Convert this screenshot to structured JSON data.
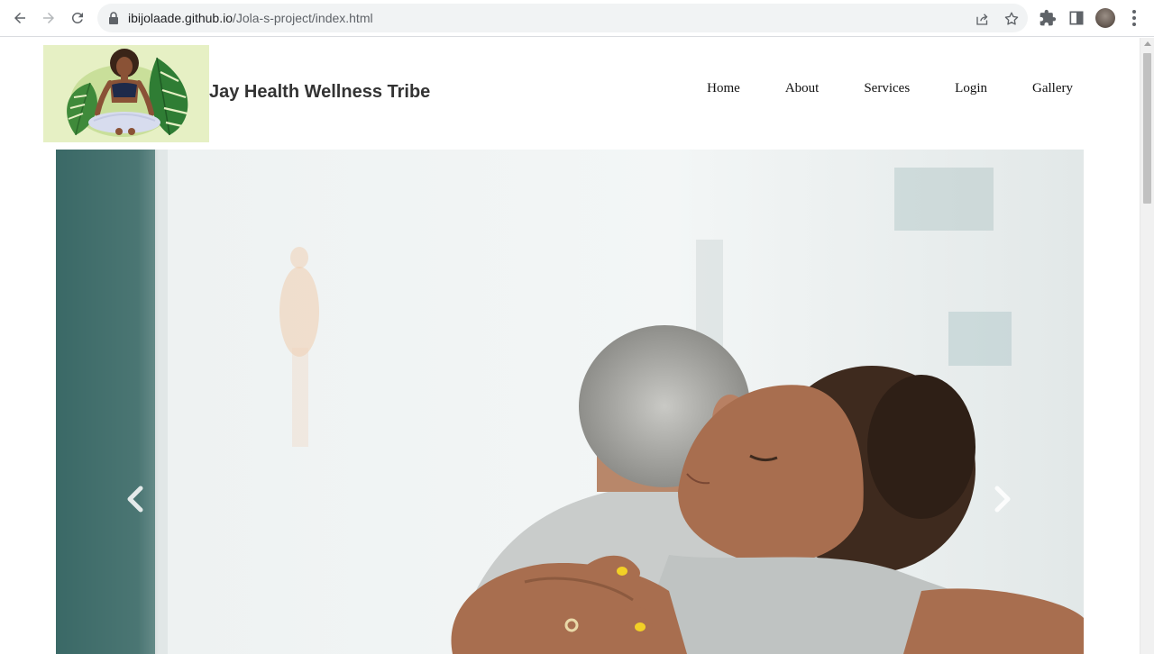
{
  "browser": {
    "url_host": "ibijolaade.github.io",
    "url_path": "/Jola-s-project/index.html",
    "icons": [
      "back-icon",
      "forward-icon",
      "reload-icon",
      "lock-icon",
      "share-icon",
      "star-icon",
      "extensions-icon",
      "side-panel-icon",
      "profile-avatar",
      "menu-icon"
    ]
  },
  "site": {
    "title": "Jay Health Wellness Tribe",
    "nav": [
      "Home",
      "About",
      "Services",
      "Login",
      "Gallery"
    ]
  },
  "carousel": {
    "prev_icon": "chevron-left-icon",
    "next_icon": "chevron-right-icon"
  },
  "colors": {
    "logo_bg": "#e6f0c4",
    "title_text": "#333333"
  }
}
